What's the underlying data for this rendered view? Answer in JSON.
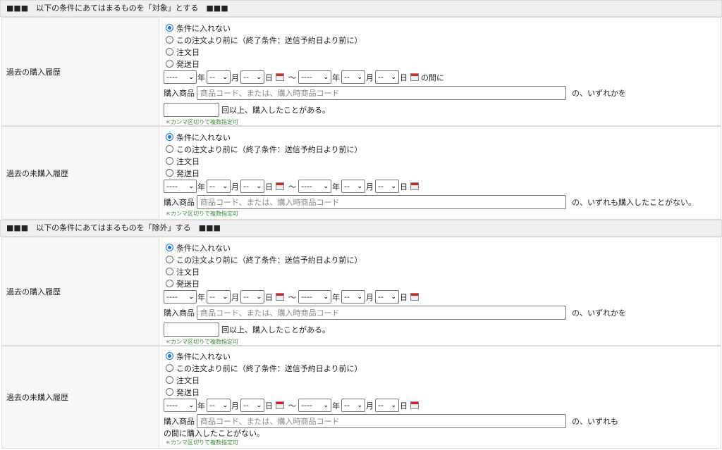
{
  "sections": [
    {
      "header": "■■■　以下の条件にあてはまるものを「対象」とする　■■■"
    },
    {
      "header": "■■■　以下の条件にあてはまるものを「除外」する　■■■"
    }
  ],
  "radio_options": [
    "条件に入れない",
    "この注文より前に（終了条件：送信予約日より前に）",
    "注文日",
    "発送日"
  ],
  "date": {
    "year_value": "----",
    "md_value": "--",
    "year_unit": "年",
    "month_unit": "月",
    "day_unit": "日",
    "tilde": "～",
    "between": "の間に"
  },
  "product": {
    "label": "購入商品",
    "placeholder": "商品コード、または、購入時商品コード"
  },
  "hint": "＊カンマ区切りで複数指定可",
  "rows": [
    {
      "label": "過去の購入履歴",
      "suffix": "の、いずれかを",
      "count_suffix": "回以上、購入したことがある。"
    },
    {
      "label": "過去の未購入履歴",
      "suffix": "の、いずれも購入したことがない。"
    },
    {
      "label": "過去の購入履歴",
      "suffix": "の、いずれかを",
      "count_suffix": "回以上、購入したことがある。"
    },
    {
      "label": "過去の未購入履歴",
      "suffix": "の、いずれも",
      "note": "の間に購入したことがない。"
    }
  ],
  "colors": {
    "accent": "#1a73e8",
    "hint": "#3a8b3a",
    "label_bg": "#f7f7f7",
    "header_bg": "#f0f0f0"
  }
}
